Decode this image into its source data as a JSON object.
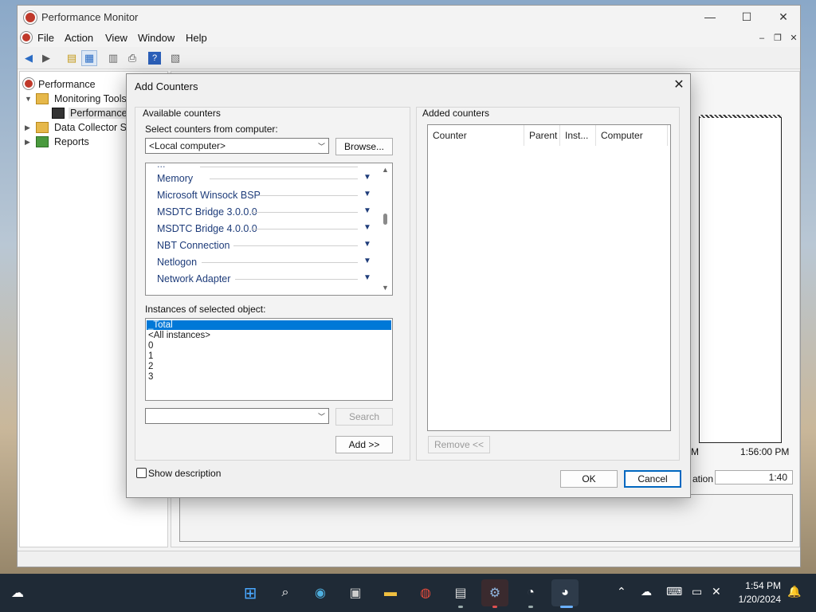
{
  "window": {
    "title": "Performance Monitor",
    "menu": [
      "File",
      "Action",
      "View",
      "Window",
      "Help"
    ]
  },
  "tree": {
    "items": [
      {
        "label": "Performance"
      },
      {
        "label": "Monitoring Tools"
      },
      {
        "label": "Performance M"
      },
      {
        "label": "Data Collector Set"
      },
      {
        "label": "Reports"
      }
    ]
  },
  "background_graph": {
    "time_label": "1:56:00 PM",
    "partial_time": "M",
    "duration_label": "ation",
    "duration_value": "1:40"
  },
  "dialog": {
    "title": "Add Counters",
    "available_label": "Available counters",
    "select_from_label": "Select counters from computer:",
    "computer_value": "<Local computer>",
    "browse_label": "Browse...",
    "counters": [
      "Memory",
      "Microsoft Winsock BSP",
      "MSDTC Bridge 3.0.0.0",
      "MSDTC Bridge 4.0.0.0",
      "NBT Connection",
      "Netlogon",
      "Network Adapter"
    ],
    "instances_label": "Instances of selected object:",
    "instances": [
      "_Total",
      "<All instances>",
      "0",
      "1",
      "2",
      "3"
    ],
    "search_label": "Search",
    "add_label": "Add >>",
    "added_label": "Added counters",
    "added_columns": [
      "Counter",
      "Parent",
      "Inst...",
      "Computer"
    ],
    "remove_label": "Remove <<",
    "show_description_label": "Show description",
    "ok_label": "OK",
    "cancel_label": "Cancel"
  },
  "taskbar": {
    "time": "1:54 PM",
    "date": "1/20/2024"
  },
  "colors": {
    "selection": "#0078d7",
    "counter_text": "#1e3c7a",
    "taskbar": "#1f2a36"
  }
}
